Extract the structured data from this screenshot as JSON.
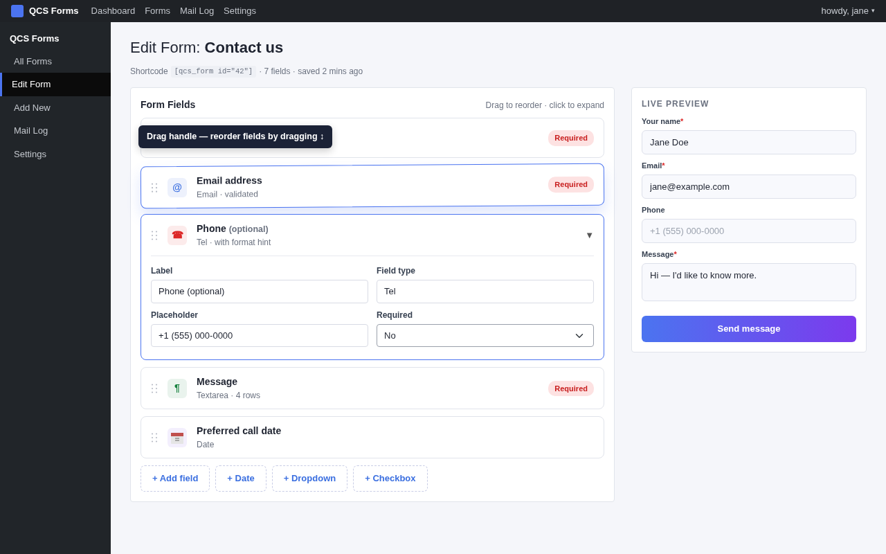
{
  "topbar": {
    "brand": "QCS Forms",
    "links": [
      "Dashboard",
      "Forms",
      "Mail Log",
      "Settings"
    ],
    "user": "howdy, jane",
    "user_caret": "▾"
  },
  "sidebar": {
    "title": "QCS Forms",
    "items": [
      {
        "label": "All Forms",
        "selected": false
      },
      {
        "label": "Edit Form",
        "selected": true
      },
      {
        "label": "Add New",
        "selected": false
      },
      {
        "label": "Mail Log",
        "selected": false
      },
      {
        "label": "Settings",
        "selected": false
      }
    ]
  },
  "page": {
    "title_prefix": "Edit Form:",
    "title_name": "Contact us",
    "meta_label": "Shortcode",
    "shortcode": "[qcs_form id=\"42\"]",
    "meta_rest": "· 7 fields · saved 2 mins ago"
  },
  "fields_card": {
    "title": "Form Fields",
    "hint": "Drag to reorder · click to expand",
    "tooltip": "Drag handle — reorder fields by dragging ↕",
    "fields": [
      {
        "kind": "covered",
        "badge": "Required",
        "dragging": false,
        "expanded": false
      },
      {
        "kind": "glyph",
        "icon": "@",
        "color": "#3b6fe0",
        "title": "Email address",
        "subtitle": "Email · validated",
        "badge": "Required",
        "dragging": true,
        "expanded": false
      },
      {
        "kind": "glyph",
        "icon": "☎",
        "color": "#dc2626",
        "title": "Phone",
        "title_note": "(optional)",
        "subtitle": "Tel · with format hint",
        "dragging": false,
        "expanded": true,
        "toggle": "▼",
        "editor": [
          {
            "label": "Label",
            "kind": "input",
            "value": "Phone (optional)"
          },
          {
            "label": "Field type",
            "kind": "input",
            "value": "Tel"
          },
          {
            "label": "Placeholder",
            "kind": "input",
            "value": "+1 (555) 000-0000"
          },
          {
            "label": "Required",
            "kind": "select",
            "value": "No"
          }
        ]
      },
      {
        "kind": "glyph",
        "icon": "¶",
        "color": "#15803d",
        "title": "Message",
        "subtitle": "Textarea · 4 rows",
        "badge": "Required",
        "dragging": false,
        "expanded": false
      },
      {
        "kind": "calendar",
        "title": "Preferred call date",
        "subtitle": "Date",
        "dragging": false,
        "expanded": false
      }
    ],
    "add_buttons": [
      "+ Add field",
      "+ Date",
      "+ Dropdown",
      "+ Checkbox"
    ]
  },
  "preview": {
    "title": "LIVE PREVIEW",
    "required_mark": "*",
    "fields": [
      {
        "label": "Your name",
        "required": true,
        "kind": "input",
        "value": "Jane Doe"
      },
      {
        "label": "Email",
        "required": true,
        "kind": "input",
        "value": "jane@example.com"
      },
      {
        "label": "Phone",
        "required": false,
        "kind": "input",
        "placeholder": "+1 (555) 000-0000"
      },
      {
        "label": "Message",
        "required": true,
        "kind": "textarea",
        "value": "Hi — I'd like to know more."
      }
    ],
    "submit": "Send message"
  }
}
